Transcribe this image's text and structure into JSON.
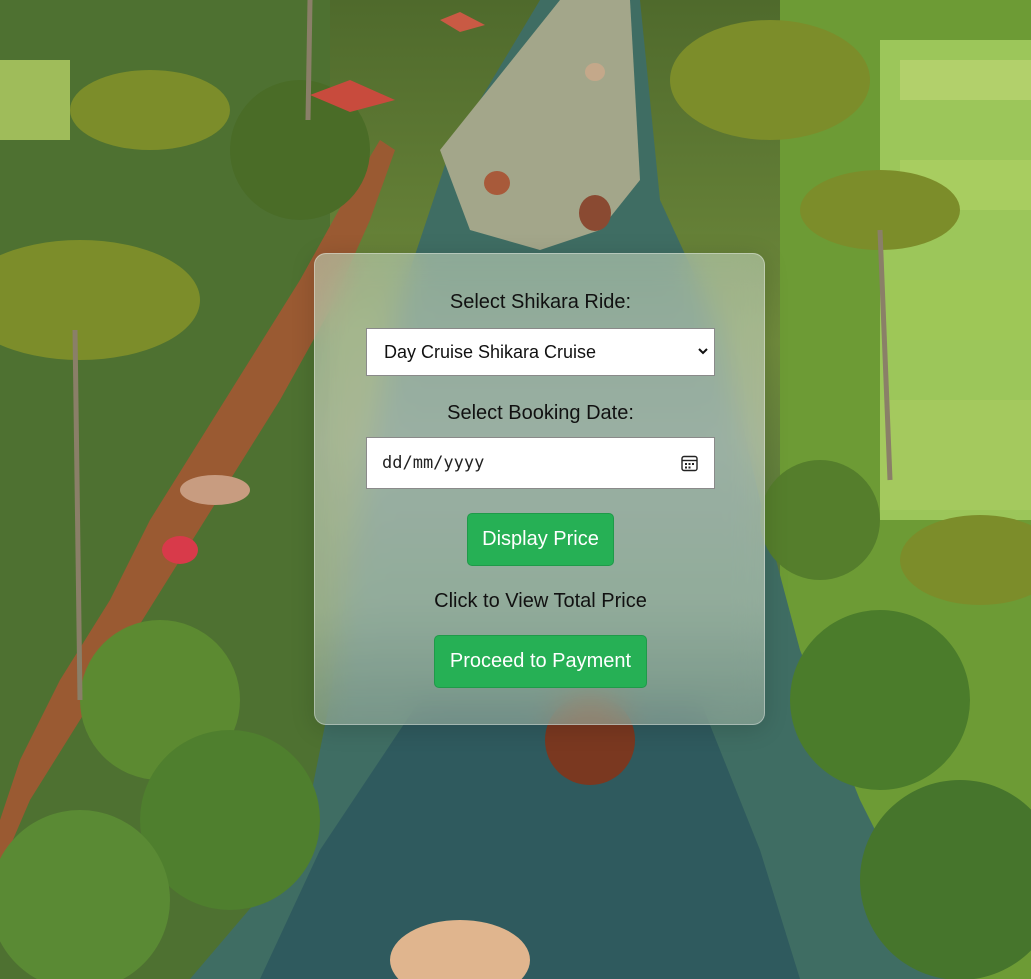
{
  "form": {
    "ride_label": "Select Shikara Ride:",
    "ride_selected": "Day Cruise Shikara Cruise",
    "date_label": "Select Booking Date:",
    "date_placeholder": "dd/mm/yyyy",
    "display_price_button": "Display Price",
    "price_hint": "Click to View Total Price",
    "payment_button": "Proceed to Payment"
  },
  "icons": {
    "dropdown": "chevron-down-icon",
    "date": "calendar-icon"
  },
  "colors": {
    "button_green": "#26b055",
    "card_background": "rgba(255,255,255,0.18)"
  }
}
